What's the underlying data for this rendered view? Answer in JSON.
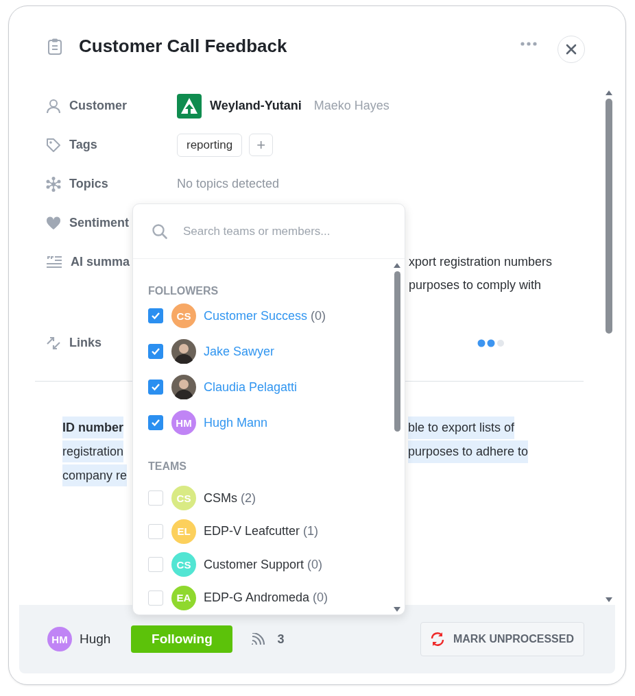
{
  "header": {
    "title": "Customer Call Feedback"
  },
  "fields": [
    {
      "kind": "customer",
      "label": "Customer",
      "company": "Weyland-Yutani",
      "contact": "Maeko Hayes"
    },
    {
      "kind": "tags",
      "label": "Tags",
      "tags": [
        "reporting"
      ],
      "add": "+"
    },
    {
      "kind": "topics",
      "label": "Topics",
      "value": "No topics detected"
    },
    {
      "kind": "sentiment",
      "label": "Sentiment"
    },
    {
      "kind": "summary",
      "label": "AI summa",
      "lines": [
        "xport registration numbers",
        "purposes to comply with"
      ]
    },
    {
      "kind": "links",
      "label": "Links"
    }
  ],
  "note": {
    "lines": [
      {
        "left": "**ID number**",
        "right": "ble to export lists of"
      },
      {
        "left": "registration",
        "right": "purposes to adhere to"
      },
      {
        "left": "company re"
      }
    ]
  },
  "dropdown": {
    "search": {
      "placeholder": "Search teams or members..."
    },
    "sections": [
      {
        "title": "FOLLOWERS",
        "items": [
          {
            "name": "Customer Success",
            "count": "(0)",
            "checked": true,
            "kind": "initials",
            "initials": "CS",
            "color": "#f7a865"
          },
          {
            "name": "Jake Sawyer",
            "checked": true,
            "kind": "photo"
          },
          {
            "name": "Claudia Pelagatti",
            "checked": true,
            "kind": "photo"
          },
          {
            "name": "Hugh Mann",
            "checked": true,
            "kind": "initials",
            "initials": "HM",
            "color": "#c084f5"
          }
        ]
      },
      {
        "title": "TEAMS",
        "items": [
          {
            "name": "CSMs",
            "count": "(2)",
            "checked": false,
            "kind": "initials",
            "initials": "CS",
            "color": "#d9ea84"
          },
          {
            "name": "EDP-V Leafcutter",
            "count": "(1)",
            "checked": false,
            "kind": "initials",
            "initials": "EL",
            "color": "#fcd05c"
          },
          {
            "name": "Customer Support",
            "count": "(0)",
            "checked": false,
            "kind": "initials",
            "initials": "CS",
            "color": "#52e5d3"
          },
          {
            "name": "EDP-G Andromeda",
            "count": "(0)",
            "checked": false,
            "kind": "initials",
            "initials": "EA",
            "color": "#8fd82e"
          }
        ]
      }
    ]
  },
  "footer": {
    "user": {
      "initials": "HM",
      "name": "Hugh",
      "color": "#c084f5"
    },
    "follow_button": "Following",
    "followers_count": "3",
    "mark_button": "MARK UNPROCESSED"
  }
}
